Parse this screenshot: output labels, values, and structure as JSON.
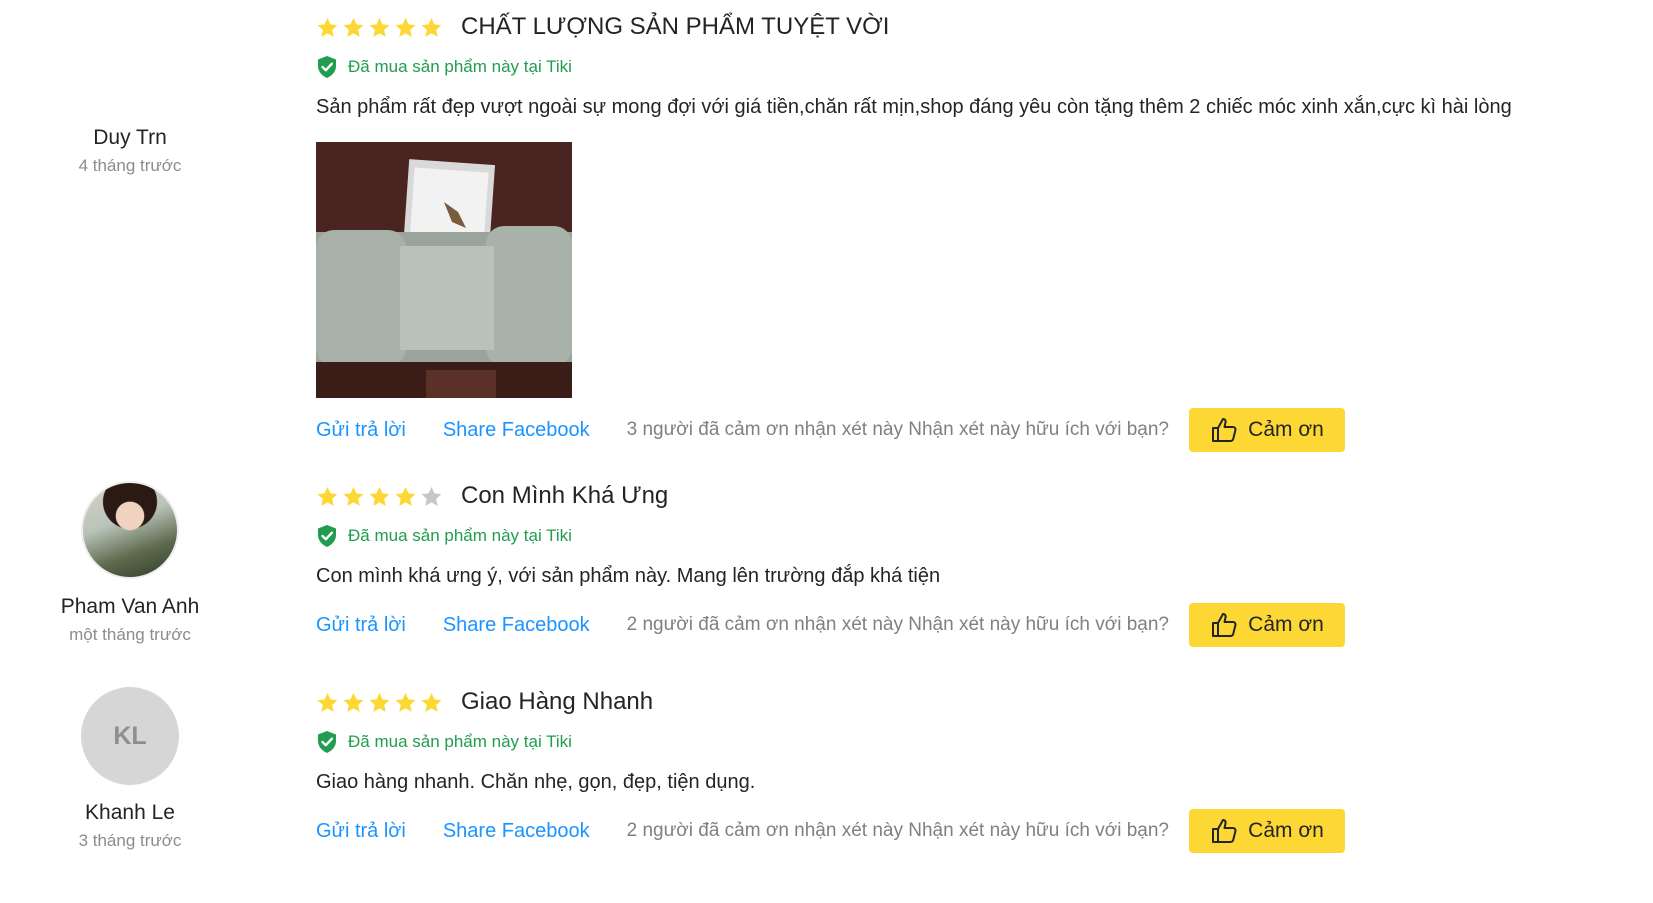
{
  "reviews": [
    {
      "user": {
        "name": "Duy Trn",
        "time": "4 tháng trước"
      },
      "rating": 5,
      "title": "CHẤT LƯỢNG SẢN PHẨM TUYỆT VỜI",
      "verified": "Đã mua sản phẩm này tại Tiki",
      "body": "Sản phẩm rất đẹp vượt ngoài sự mong đợi với giá tiền,chăn rất mịn,shop đáng yêu còn tặng thêm 2 chiếc móc xinh xắn,cực kì hài lòng",
      "reply_label": "Gửi trả lời",
      "share_label": "Share Facebook",
      "thanks_text": "3 người đã cảm ơn nhận xét này Nhận xét này hữu ích với bạn?",
      "thanks_button": "Cảm ơn"
    },
    {
      "user": {
        "name": "Pham Van Anh",
        "time": "một tháng trước"
      },
      "rating": 4,
      "title": "Con Mình Khá Ưng",
      "verified": "Đã mua sản phẩm này tại Tiki",
      "body": "Con mình khá ưng ý, với sản phẩm này. Mang lên trường đắp khá tiện",
      "reply_label": "Gửi trả lời",
      "share_label": "Share Facebook",
      "thanks_text": "2 người đã cảm ơn nhận xét này Nhận xét này hữu ích với bạn?",
      "thanks_button": "Cảm ơn"
    },
    {
      "user": {
        "name": "Khanh Le",
        "time": "3 tháng trước",
        "initials": "KL"
      },
      "rating": 5,
      "title": "Giao Hàng Nhanh",
      "verified": "Đã mua sản phẩm này tại Tiki",
      "body": "Giao hàng nhanh. Chăn nhẹ, gọn, đẹp, tiện dụng.",
      "reply_label": "Gửi trả lời",
      "share_label": "Share Facebook",
      "thanks_text": "2 người đã cảm ơn nhận xét này Nhận xét này hữu ích với bạn?",
      "thanks_button": "Cảm ơn"
    }
  ],
  "colors": {
    "star_filled": "#fdd835",
    "star_empty": "#c7c7c7",
    "verified_green": "#229c4f",
    "link_blue": "#1a94ff",
    "button_yellow": "#fdd835"
  },
  "icons": {
    "star": "star-icon",
    "verified": "shield-check-icon",
    "thanks": "thumbs-up-icon"
  }
}
